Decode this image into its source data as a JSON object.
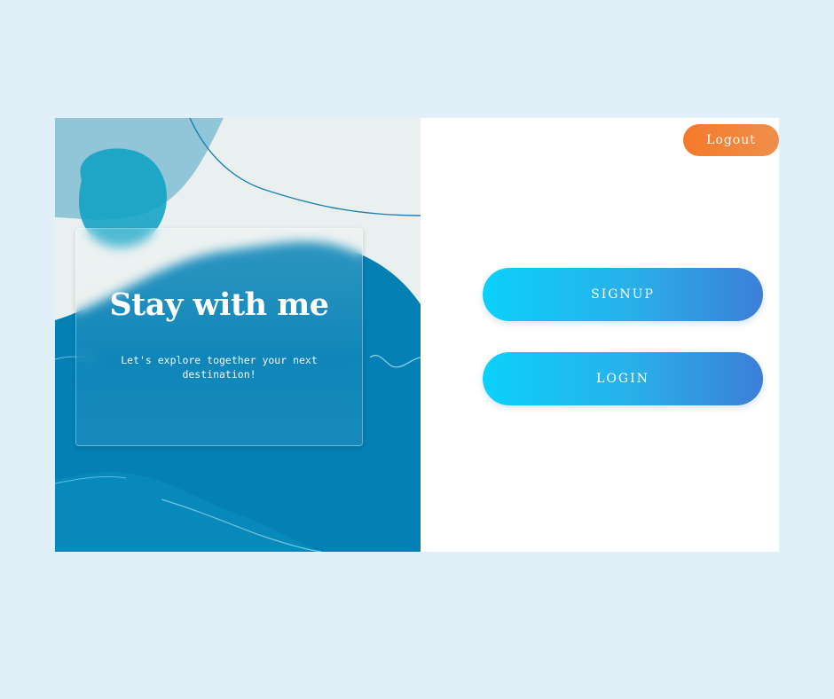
{
  "hero": {
    "title": "Stay with me",
    "subtitle": "Let's explore together your next destination!"
  },
  "header": {
    "logout_label": "Logout"
  },
  "actions": {
    "signup_label": "SIGNUP",
    "login_label": "LOGIN"
  },
  "colors": {
    "page_background": "#e1eff8",
    "ocean_blue": "#0480b5",
    "logout_gradient": [
      "#f47a2a",
      "#ef8f4b"
    ],
    "button_gradient": [
      "#0bd1fb",
      "#3c7ed8"
    ]
  }
}
